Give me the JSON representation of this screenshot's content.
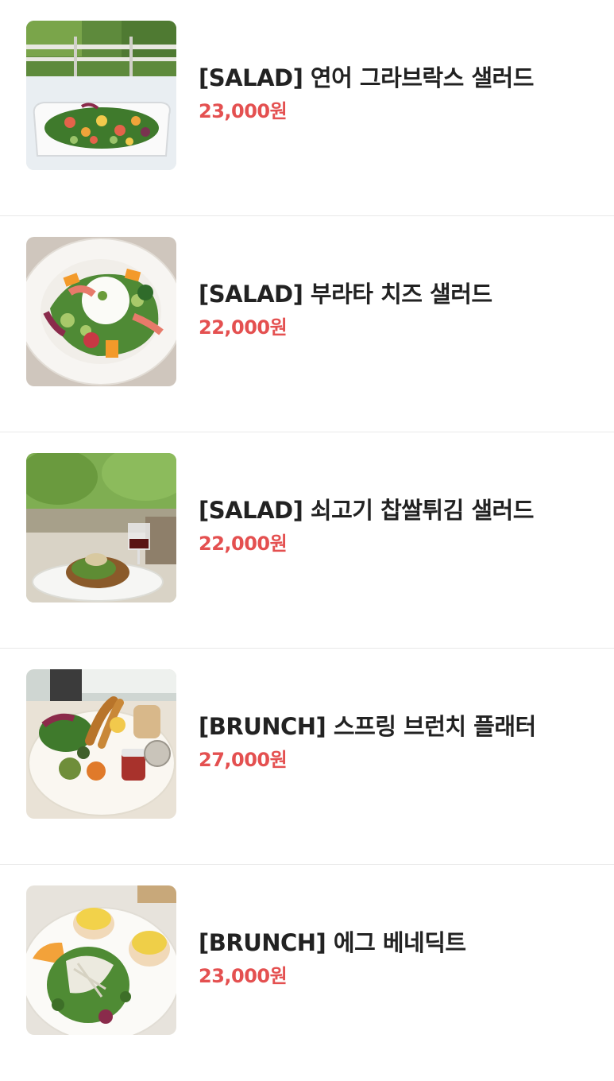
{
  "menu": {
    "items": [
      {
        "name": "[SALAD] 연어 그라브락스 샐러드",
        "price": "23,000원",
        "image": "salmon-gravlax-salad-photo"
      },
      {
        "name": "[SALAD] 부라타 치즈 샐러드",
        "price": "22,000원",
        "image": "burrata-cheese-salad-photo"
      },
      {
        "name": "[SALAD] 쇠고기 찹쌀튀김 샐러드",
        "price": "22,000원",
        "image": "beef-fried-salad-photo"
      },
      {
        "name": "[BRUNCH] 스프링 브런치 플래터",
        "price": "27,000원",
        "image": "spring-brunch-platter-photo"
      },
      {
        "name": "[BRUNCH] 에그 베네딕트",
        "price": "23,000원",
        "image": "eggs-benedict-photo"
      }
    ]
  }
}
